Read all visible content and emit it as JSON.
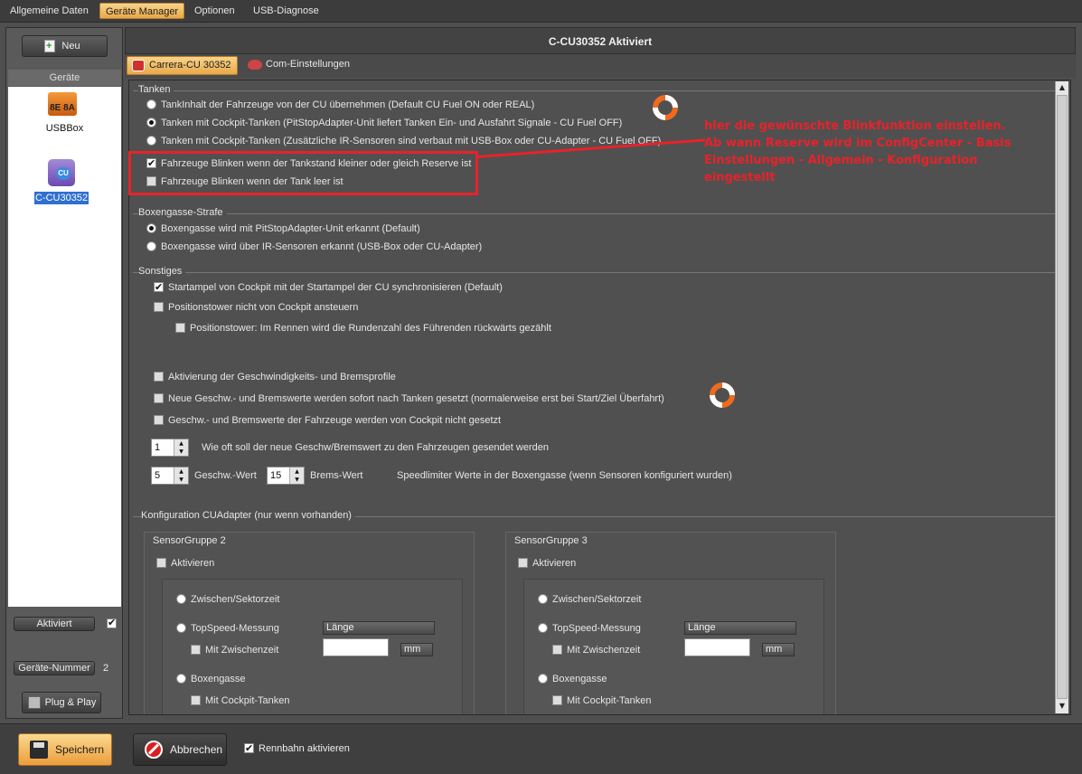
{
  "menu": {
    "items": [
      {
        "label": "Allgemeine Daten",
        "active": false
      },
      {
        "label": "Geräte Manager",
        "active": true
      },
      {
        "label": "Optionen",
        "active": false
      },
      {
        "label": "USB-Diagnose",
        "active": false
      }
    ]
  },
  "sidebar": {
    "new_label": "Neu",
    "devices_header": "Geräte",
    "devices": [
      {
        "label": "USBBox",
        "icon_text": "8E 8A",
        "selected": false
      },
      {
        "label": "C-CU30352",
        "selected": true
      }
    ],
    "activated_label": "Aktiviert",
    "activated_checked": true,
    "device_number_label": "Geräte-Nummer",
    "device_number_value": "2",
    "plug_play_label": "Plug & Play"
  },
  "main": {
    "title": "C-CU30352 Aktiviert",
    "tabs": [
      {
        "label": "Carrera-CU 30352",
        "active": true
      },
      {
        "label": "Com-Einstellungen",
        "active": false
      }
    ]
  },
  "tanken": {
    "title": "Tanken",
    "options": [
      {
        "label": "TankInhalt der Fahrzeuge von der CU übernehmen (Default CU Fuel ON oder REAL)",
        "checked": false
      },
      {
        "label": "Tanken mit Cockpit-Tanken (PitStopAdapter-Unit liefert Tanken Ein- und Ausfahrt Signale - CU Fuel OFF)",
        "checked": true
      },
      {
        "label": "Tanken mit Cockpit-Tanken (Zusätzliche IR-Sensoren sind verbaut mit USB-Box oder CU-Adapter - CU Fuel OFF)",
        "checked": false
      }
    ],
    "blink_reserve": {
      "label": "Fahrzeuge Blinken wenn der Tankstand kleiner oder gleich Reserve ist",
      "checked": true
    },
    "blink_empty": {
      "label": "Fahrzeuge Blinken wenn der Tank leer ist",
      "checked": false
    }
  },
  "annotation": {
    "text": "hier die gewünschte Blinkfunktion einstellen.\nAb wann Reserve wird im ConfigCenter - Basis\nEinstellungen - Allgemein - Konfiguration\neingestellt",
    "color": "#e8222a"
  },
  "boxengasse": {
    "title": "Boxengasse-Strafe",
    "options": [
      {
        "label": "Boxengasse wird mit PitStopAdapter-Unit erkannt (Default)",
        "checked": true
      },
      {
        "label": "Boxengasse wird über IR-Sensoren erkannt (USB-Box oder CU-Adapter)",
        "checked": false
      }
    ]
  },
  "sonstiges": {
    "title": "Sonstiges",
    "startampel": {
      "label": "Startampel von Cockpit mit der Startampel der CU synchronisieren (Default)",
      "checked": true
    },
    "positionstower": {
      "label": "Positionstower nicht von Cockpit ansteuern",
      "checked": false
    },
    "positionstower_rennen": {
      "label": "Positionstower: Im Rennen wird die Rundenzahl des Führenden rückwärts gezählt",
      "checked": false
    },
    "aktivierung_profile": {
      "label": "Aktivierung der Geschwindigkeits- und Bremsprofile",
      "checked": false
    },
    "neue_werte": {
      "label": "Neue Geschw.- und Bremswerte werden sofort nach Tanken gesetzt (normalerweise erst bei Start/Ziel Überfahrt)",
      "checked": false
    },
    "nicht_gesetzt": {
      "label": "Geschw.- und Bremswerte der Fahrzeuge werden von Cockpit nicht gesetzt",
      "checked": false
    },
    "frequency_value": "1",
    "frequency_label": "Wie oft soll der neue Geschw/Bremswert zu den Fahrzeugen gesendet werden",
    "speed_value": "5",
    "speed_label": "Geschw.-Wert",
    "brake_value": "15",
    "brake_label": "Brems-Wert",
    "speedlimiter_label": "Speedlimiter Werte in der Boxengasse (wenn Sensoren konfiguriert wurden)"
  },
  "cuadapter": {
    "title": "Konfiguration CUAdapter (nur wenn vorhanden)",
    "groups": [
      {
        "title": "SensorGruppe 2",
        "activate_label": "Aktivieren",
        "zwischen_label": "Zwischen/Sektorzeit",
        "topspeed_label": "TopSpeed-Messung",
        "laenge_label": "Länge",
        "mit_zwischenzeit_label": "Mit Zwischenzeit",
        "unit_label": "mm",
        "boxengasse_label": "Boxengasse",
        "cockpit_tanken_label": "Mit Cockpit-Tanken"
      },
      {
        "title": "SensorGruppe 3",
        "activate_label": "Aktivieren",
        "zwischen_label": "Zwischen/Sektorzeit",
        "topspeed_label": "TopSpeed-Messung",
        "laenge_label": "Länge",
        "mit_zwischenzeit_label": "Mit Zwischenzeit",
        "unit_label": "mm",
        "boxengasse_label": "Boxengasse",
        "cockpit_tanken_label": "Mit Cockpit-Tanken"
      }
    ]
  },
  "footer": {
    "save_label": "Speichern",
    "cancel_label": "Abbrechen",
    "activate_track_label": "Rennbahn aktivieren",
    "activate_track_checked": true
  },
  "colors": {
    "accent_orange": "#e8a84a",
    "annotation_red": "#e8222a",
    "background": "#4f4f4f"
  }
}
